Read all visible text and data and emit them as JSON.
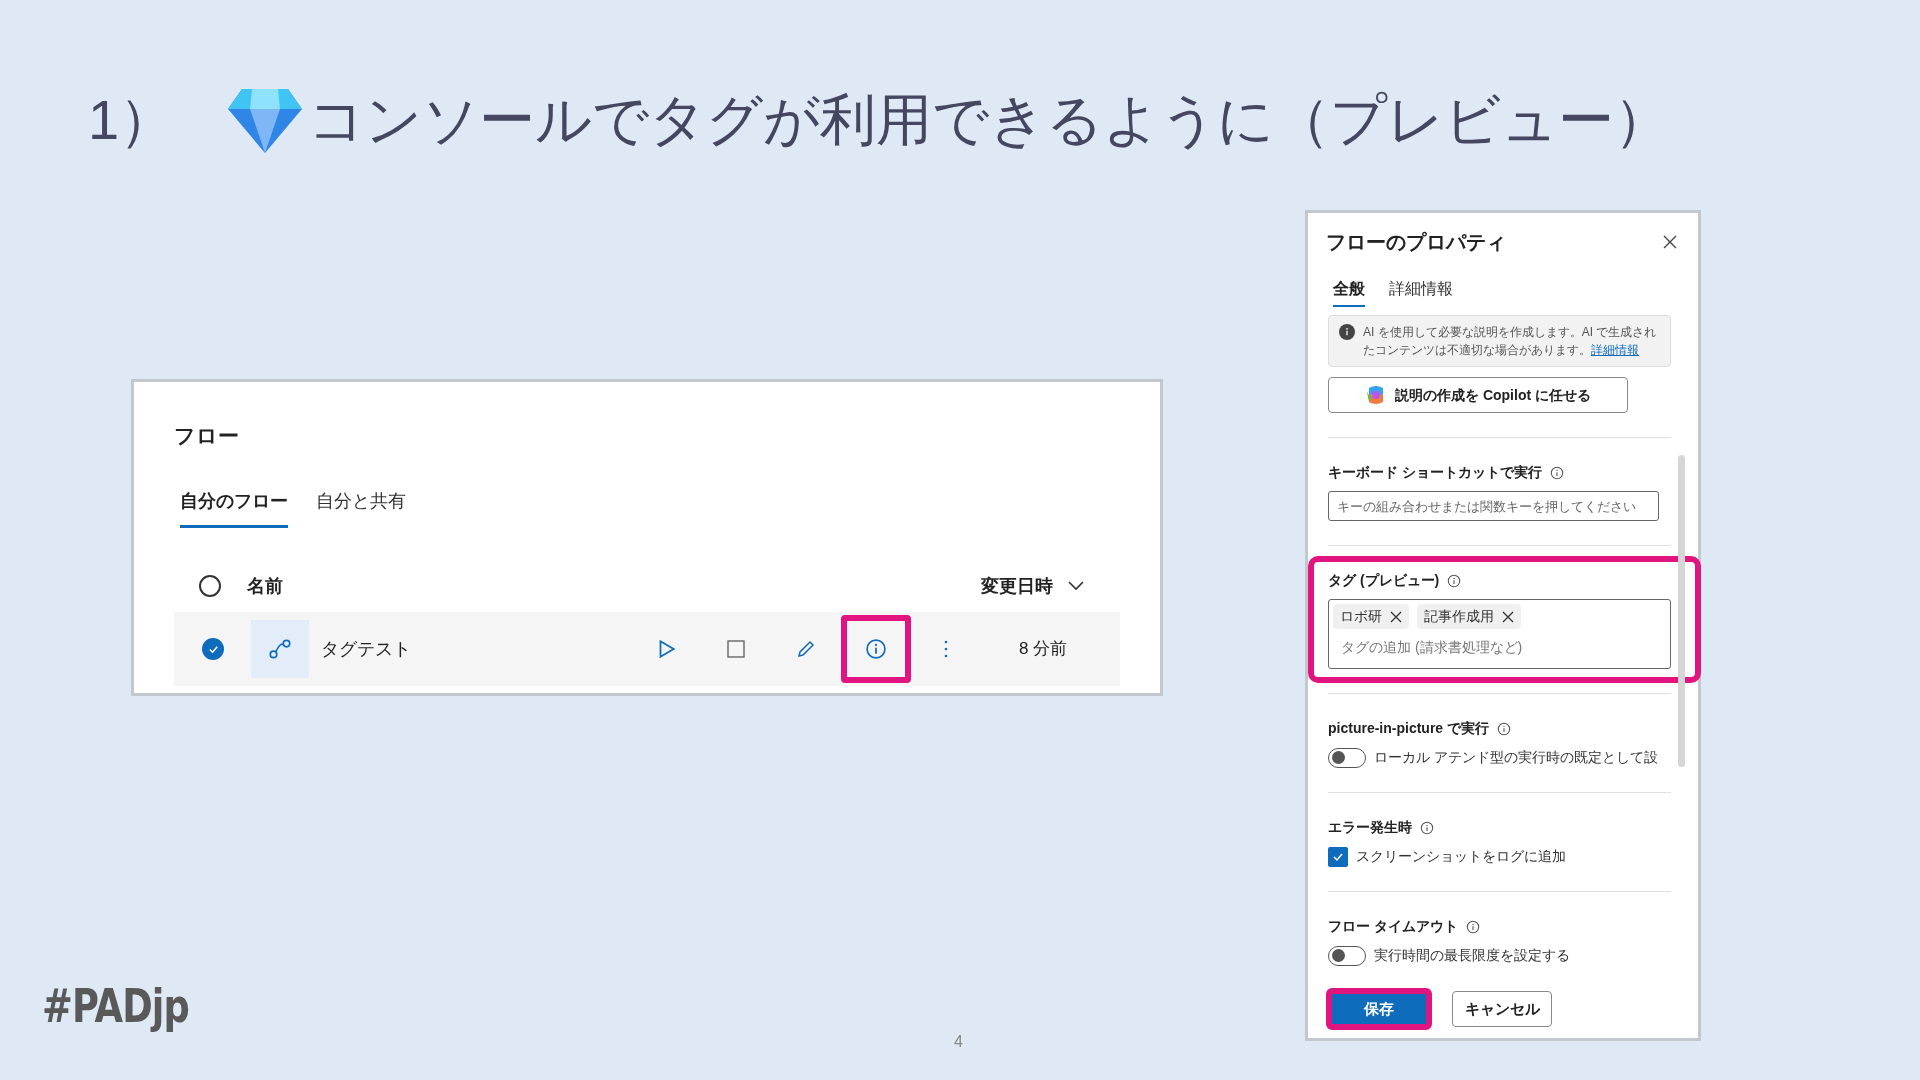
{
  "slide": {
    "number_label": "1）",
    "title": "コンソールでタグが利用できるように（プレビュー）",
    "hashtag": "#PADjp",
    "page_number": "4"
  },
  "flows_panel": {
    "title": "フロー",
    "tabs": [
      {
        "label": "自分のフロー",
        "selected": true
      },
      {
        "label": "自分と共有",
        "selected": false
      }
    ],
    "columns": {
      "name": "名前",
      "modified": "変更日時",
      "all_selected": false
    },
    "rows": [
      {
        "name": "タグテスト",
        "modified": "8 分前",
        "selected": true,
        "actions": [
          {
            "kind": "run",
            "highlighted": false
          },
          {
            "kind": "stop",
            "highlighted": false
          },
          {
            "kind": "edit",
            "highlighted": false
          },
          {
            "kind": "info",
            "highlighted": true
          },
          {
            "kind": "more",
            "highlighted": false
          }
        ]
      }
    ]
  },
  "properties_panel": {
    "title": "フローのプロパティ",
    "tabs": [
      {
        "label": "全般",
        "selected": true
      },
      {
        "label": "詳細情報",
        "selected": false
      }
    ],
    "notice": {
      "text": "AI を使用して必要な説明を作成します。AI で生成されたコンテンツは不適切な場合があります。",
      "link": "詳細情報"
    },
    "copilot_button": "説明の作成を Copilot に任せる",
    "sections": [
      {
        "kind": "input",
        "label": "キーボード ショートカットで実行",
        "placeholder": "キーの組み合わせまたは関数キーを押してください",
        "highlighted": false
      },
      {
        "kind": "tags",
        "label": "タグ (プレビュー)",
        "tags": [
          "ロボ研",
          "記事作成用"
        ],
        "placeholder": "タグの追加 (請求書処理など)",
        "highlighted": true
      },
      {
        "kind": "toggle",
        "label": "picture-in-picture で実行",
        "text": "ローカル アテンド型の実行時の既定として設",
        "on": false,
        "highlighted": false
      },
      {
        "kind": "checkbox",
        "label": "エラー発生時",
        "text": "スクリーンショットをログに追加",
        "checked": true,
        "highlighted": false
      },
      {
        "kind": "toggle",
        "label": "フロー タイムアウト",
        "text": "実行時間の最長限度を設定する",
        "on": false,
        "highlighted": false
      }
    ],
    "buttons": [
      {
        "kind": "primary",
        "label": "保存",
        "highlighted": true
      },
      {
        "kind": "secondary",
        "label": "キャンセル",
        "highlighted": false
      }
    ]
  }
}
